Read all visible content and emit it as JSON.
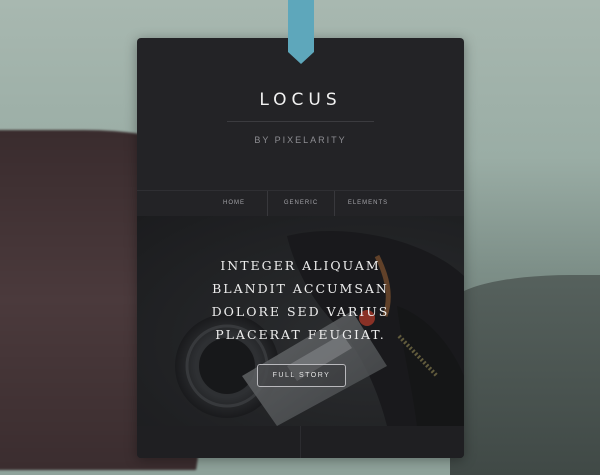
{
  "site": {
    "title": "LOCUS",
    "byline": "BY PIXELARITY"
  },
  "nav": {
    "items": [
      {
        "label": "HOME"
      },
      {
        "label": "GENERIC"
      },
      {
        "label": "ELEMENTS"
      }
    ]
  },
  "hero": {
    "lines": [
      "INTEGER ALIQUAM",
      "BLANDIT ACCUMSAN",
      "DOLORE SED VARIUS",
      "PLACERAT FEUGIAT."
    ],
    "button_label": "FULL STORY"
  },
  "colors": {
    "ribbon": "#5ea7bb",
    "card_bg": "#232326",
    "accent_red": "#c9412e"
  },
  "icons": {
    "ribbon": "bookmark-ribbon-icon"
  }
}
